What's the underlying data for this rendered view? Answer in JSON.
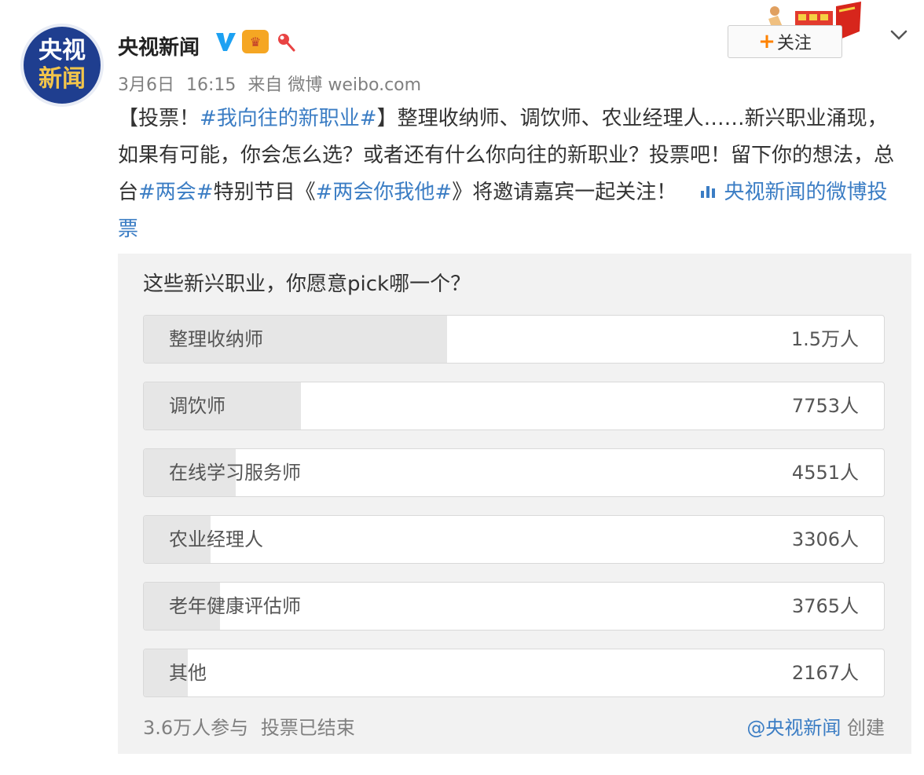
{
  "post": {
    "avatar_line1": "央视",
    "avatar_line2": "新闻",
    "username": "央视新闻",
    "follow_label": "关注",
    "follow_plus": "+",
    "date": "3月6日",
    "time": "16:15",
    "source": "来自 微博 weibo.com",
    "text_parts": {
      "p1": "【投票！",
      "tag1": "#我向往的新职业#",
      "p2": "】整理收纳师、调饮师、农业经理人……新兴职业涌现，如果有可能，你会怎么选？或者还有什么你向往的新职业？投票吧！留下你的想法，总台",
      "tag2": "#两会#",
      "p3": "特别节目《",
      "tag3": "#两会你我他#",
      "p4": "》将邀请嘉宾一起关注！",
      "vote_link": "央视新闻的微博投票"
    }
  },
  "vote": {
    "title": "这些新兴职业，你愿意pick哪一个？",
    "options": [
      {
        "label": "整理收纳师",
        "count": "1.5万人",
        "value": 15000
      },
      {
        "label": "调饮师",
        "count": "7753人",
        "value": 7753
      },
      {
        "label": "在线学习服务师",
        "count": "4551人",
        "value": 4551
      },
      {
        "label": "农业经理人",
        "count": "3306人",
        "value": 3306
      },
      {
        "label": "老年健康评估师",
        "count": "3765人",
        "value": 3765
      },
      {
        "label": "其他",
        "count": "2167人",
        "value": 2167
      }
    ],
    "participants": "3.6万人参与",
    "status": "投票已结束",
    "creator": "@央视新闻",
    "created_label": "创建"
  },
  "colors": {
    "link": "#3b7dc4",
    "follow_plus": "#ff8200",
    "avatar_bg": "#1f3e8f",
    "verified": "#1da1f2"
  }
}
